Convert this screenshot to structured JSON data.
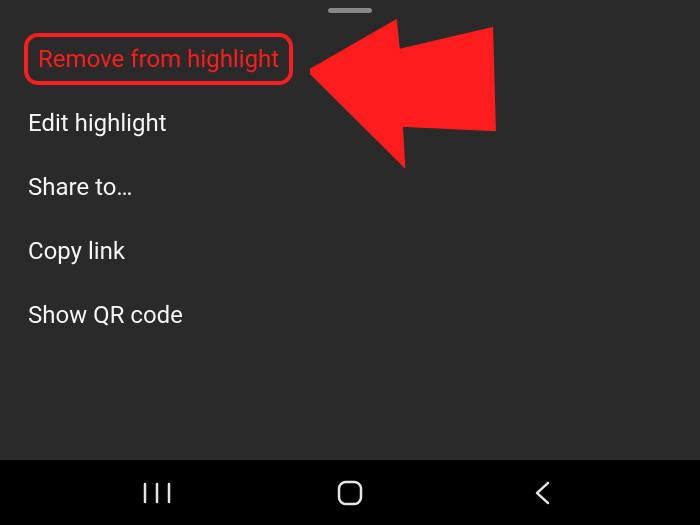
{
  "menu": {
    "items": [
      {
        "label": "Remove from highlight"
      },
      {
        "label": "Edit highlight"
      },
      {
        "label": "Share to…"
      },
      {
        "label": "Copy link"
      },
      {
        "label": "Show QR code"
      }
    ]
  },
  "annotation": {
    "arrow_color": "#ff1c1c"
  }
}
